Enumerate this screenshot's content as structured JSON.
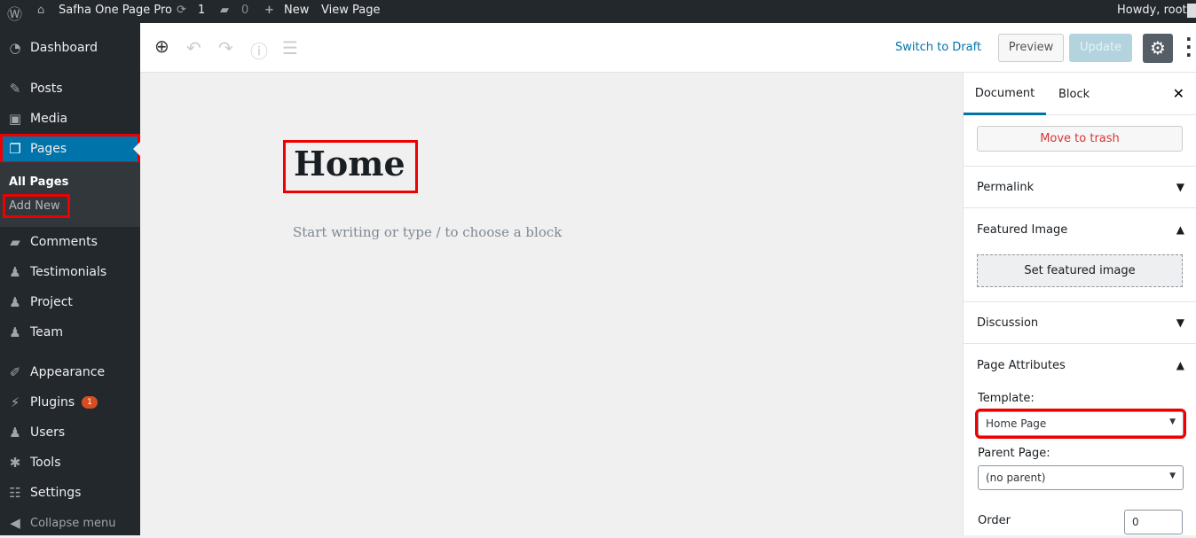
{
  "adminbar": {
    "site": "Safha One Page Pro",
    "updates": "1",
    "comments": "0",
    "new": "New",
    "view": "View Page",
    "howdy": "Howdy, root"
  },
  "sidebar": {
    "items": [
      {
        "label": "Dashboard",
        "icon": "dashboard-icon",
        "glyph": "◔"
      },
      {
        "label": "Posts",
        "icon": "pin-icon",
        "glyph": "✎"
      },
      {
        "label": "Media",
        "icon": "media-icon",
        "glyph": "▣"
      },
      {
        "label": "Pages",
        "icon": "pages-icon",
        "glyph": "❐"
      },
      {
        "label": "Comments",
        "icon": "comment-icon",
        "glyph": "▰"
      },
      {
        "label": "Testimonials",
        "icon": "person-icon",
        "glyph": "♟"
      },
      {
        "label": "Project",
        "icon": "person-icon",
        "glyph": "♟"
      },
      {
        "label": "Team",
        "icon": "person-icon",
        "glyph": "♟"
      },
      {
        "label": "Appearance",
        "icon": "brush-icon",
        "glyph": "✐"
      },
      {
        "label": "Plugins",
        "icon": "plugin-icon",
        "glyph": "⚡",
        "badge": "1"
      },
      {
        "label": "Users",
        "icon": "users-icon",
        "glyph": "♟"
      },
      {
        "label": "Tools",
        "icon": "wrench-icon",
        "glyph": "✱"
      },
      {
        "label": "Settings",
        "icon": "settings-icon",
        "glyph": "☷"
      }
    ],
    "submenu": [
      "All Pages",
      "Add New"
    ],
    "collapse": "Collapse menu"
  },
  "toolbar": {
    "switch": "Switch to Draft",
    "preview": "Preview",
    "update": "Update"
  },
  "editor": {
    "title": "Home",
    "placeholder": "Start writing or type / to choose a block"
  },
  "panel": {
    "tabs": [
      "Document",
      "Block"
    ],
    "trash": "Move to trash",
    "permalink": "Permalink",
    "featured": "Featured Image",
    "set_featured": "Set featured image",
    "discussion": "Discussion",
    "attributes": "Page Attributes",
    "template_label": "Template:",
    "template_value": "Home Page",
    "parent_label": "Parent Page:",
    "parent_value": "(no parent)",
    "order_label": "Order",
    "order_value": "0"
  },
  "colors": {
    "accent": "#0073aa",
    "highlight": "#e00000"
  }
}
